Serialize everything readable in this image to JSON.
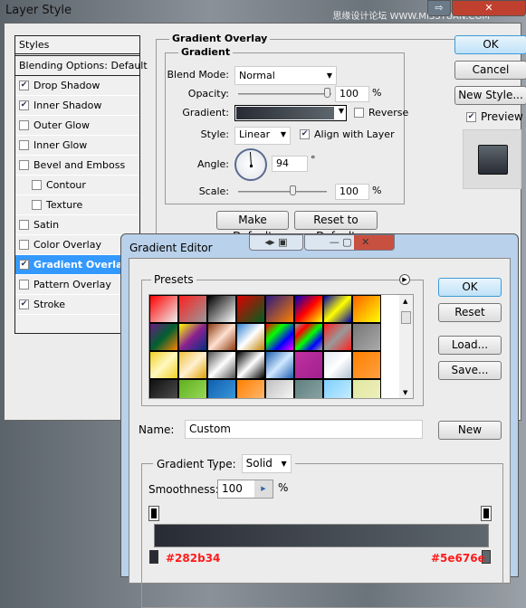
{
  "layer_style": {
    "title": "Layer Style",
    "watermark": "思缘设计论坛 WWW.MISSYUAN.COM",
    "styles_header": "Styles",
    "blending_options": "Blending Options: Default",
    "items": [
      {
        "label": "Drop Shadow",
        "checked": true,
        "indent": false
      },
      {
        "label": "Inner Shadow",
        "checked": true,
        "indent": false
      },
      {
        "label": "Outer Glow",
        "checked": false,
        "indent": false
      },
      {
        "label": "Inner Glow",
        "checked": false,
        "indent": false
      },
      {
        "label": "Bevel and Emboss",
        "checked": false,
        "indent": false
      },
      {
        "label": "Contour",
        "checked": false,
        "indent": true
      },
      {
        "label": "Texture",
        "checked": false,
        "indent": true
      },
      {
        "label": "Satin",
        "checked": false,
        "indent": false
      },
      {
        "label": "Color Overlay",
        "checked": false,
        "indent": false
      },
      {
        "label": "Gradient Overlay",
        "checked": true,
        "indent": false,
        "selected": true
      },
      {
        "label": "Pattern Overlay",
        "checked": false,
        "indent": false
      },
      {
        "label": "Stroke",
        "checked": true,
        "indent": false
      }
    ],
    "section_title": "Gradient Overlay",
    "group_title": "Gradient",
    "blend_mode_label": "Blend Mode:",
    "blend_mode": "Normal",
    "opacity_label": "Opacity:",
    "opacity": "100",
    "opacity_unit": "%",
    "gradient_label": "Gradient:",
    "reverse_label": "Reverse",
    "reverse": false,
    "style_label": "Style:",
    "style": "Linear",
    "align_label": "Align with Layer",
    "align": true,
    "angle_label": "Angle:",
    "angle": "94",
    "angle_unit": "°",
    "scale_label": "Scale:",
    "scale": "100",
    "scale_unit": "%",
    "make_default": "Make Default",
    "reset_default": "Reset to Default",
    "ok": "OK",
    "cancel": "Cancel",
    "new_style": "New Style...",
    "preview_label": "Preview",
    "preview": true
  },
  "gradient_editor": {
    "title": "Gradient Editor",
    "presets_label": "Presets",
    "ok": "OK",
    "reset": "Reset",
    "load": "Load...",
    "save": "Save...",
    "name_label": "Name:",
    "name": "Custom",
    "new": "New",
    "type_label": "Gradient Type:",
    "type": "Solid",
    "smoothness_label": "Smoothness:",
    "smoothness": "100",
    "smoothness_unit": "%",
    "color_stop_left": "#282b34",
    "color_stop_right": "#5e676e",
    "presets": [
      [
        "#ff0000",
        "#eeeeee"
      ],
      [
        "#ff2020",
        "#999999"
      ],
      [
        "#000000",
        "#ffffff"
      ],
      [
        "#dd0000",
        "#006020"
      ],
      [
        "#2a1a80",
        "#ff8000"
      ],
      [
        "#0000c0",
        "#ff0000",
        "#ffff00"
      ],
      [
        "#0000aa",
        "#ffff00",
        "#0000aa"
      ],
      [
        "#ff6000",
        "#ffff00"
      ],
      [
        "#6a1a80",
        "#006030",
        "#ff8000"
      ],
      [
        "#ffff00",
        "#8a2090",
        "#003080"
      ],
      [
        "#8a3a10",
        "#ffe0d0",
        "#8a3a10"
      ],
      [
        "#3080d0",
        "#ffffff",
        "#c08000"
      ],
      [
        "#ff0000",
        "#00ff00",
        "#0000ff",
        "#ff00ff"
      ],
      [
        "#999999",
        "#ff0000",
        "#00ff00",
        "#0000ff",
        "#999999"
      ],
      [
        "#ff2020",
        "#999999",
        "#ff2020"
      ],
      [
        "#777777",
        "#aaaaaa"
      ],
      [
        "#f0d020",
        "#fff8c0",
        "#f0d020"
      ],
      [
        "#f0c040",
        "#fff0d0",
        "#e0a000"
      ],
      [
        "#505050",
        "#ffffff",
        "#505050"
      ],
      [
        "#000000",
        "#ffffff",
        "#000000"
      ],
      [
        "#2060b0",
        "#d0e8ff",
        "#2060b0"
      ],
      [
        "#c030a0",
        "#a02090"
      ],
      [
        "#e0e8f0",
        "#ffffff",
        "#b0c0d0"
      ],
      [
        "#ff8000",
        "#ffa040"
      ],
      [
        "#111111",
        "#555555"
      ],
      [
        "#60b020",
        "#a0e060"
      ],
      [
        "#1060b0",
        "#40a0e0"
      ],
      [
        "#ff8000",
        "#ffc080"
      ],
      [
        "#c0c0c0",
        "#ffffff"
      ],
      [
        "#608080",
        "#90a8a8"
      ],
      [
        "#80d0ff",
        "#d0f0ff"
      ],
      [
        "#e0e8a0",
        "#f0f0c0"
      ]
    ]
  }
}
